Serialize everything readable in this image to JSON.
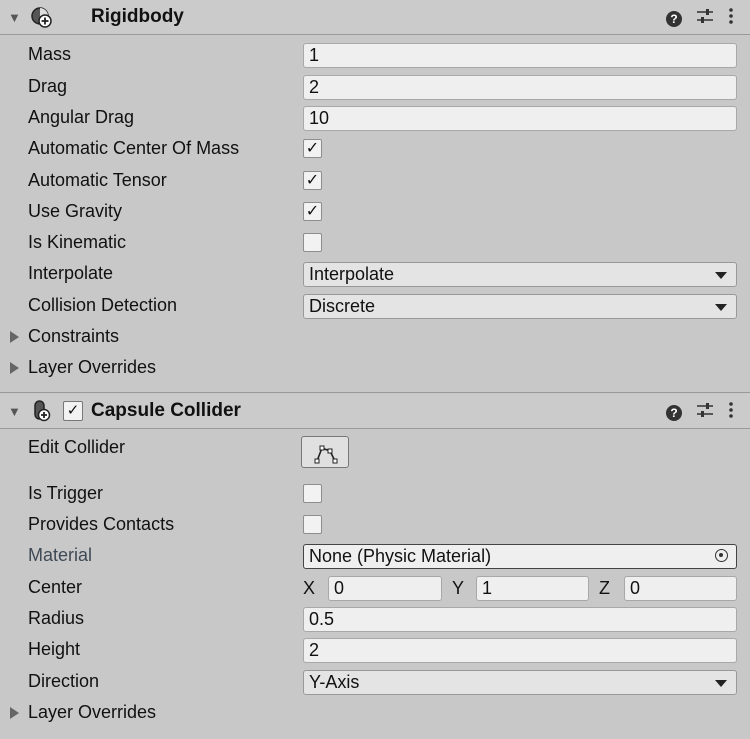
{
  "rigidbody": {
    "title": "Rigidbody",
    "fields": {
      "mass_label": "Mass",
      "mass_value": "1",
      "drag_label": "Drag",
      "drag_value": "2",
      "angular_drag_label": "Angular Drag",
      "angular_drag_value": "10",
      "auto_com_label": "Automatic Center Of Mass",
      "auto_com_checked": true,
      "auto_tensor_label": "Automatic Tensor",
      "auto_tensor_checked": true,
      "use_gravity_label": "Use Gravity",
      "use_gravity_checked": true,
      "is_kinematic_label": "Is Kinematic",
      "is_kinematic_checked": false,
      "interpolate_label": "Interpolate",
      "interpolate_value": "Interpolate",
      "collision_label": "Collision Detection",
      "collision_value": "Discrete",
      "constraints_label": "Constraints",
      "layer_overrides_label": "Layer Overrides"
    }
  },
  "capsule": {
    "title": "Capsule Collider",
    "enabled": true,
    "fields": {
      "edit_collider_label": "Edit Collider",
      "is_trigger_label": "Is Trigger",
      "is_trigger_checked": false,
      "provides_contacts_label": "Provides Contacts",
      "provides_contacts_checked": false,
      "material_label": "Material",
      "material_value": "None (Physic Material)",
      "center_label": "Center",
      "center_x_axis": "X",
      "center_x": "0",
      "center_y_axis": "Y",
      "center_y": "1",
      "center_z_axis": "Z",
      "center_z": "0",
      "radius_label": "Radius",
      "radius_value": "0.5",
      "height_label": "Height",
      "height_value": "2",
      "direction_label": "Direction",
      "direction_value": "Y-Axis",
      "layer_overrides_label": "Layer Overrides"
    }
  },
  "icons": {
    "help": "help-icon",
    "presets": "presets-icon",
    "menu": "kebab-menu-icon",
    "check_glyph": "✓",
    "help_glyph": "?"
  }
}
